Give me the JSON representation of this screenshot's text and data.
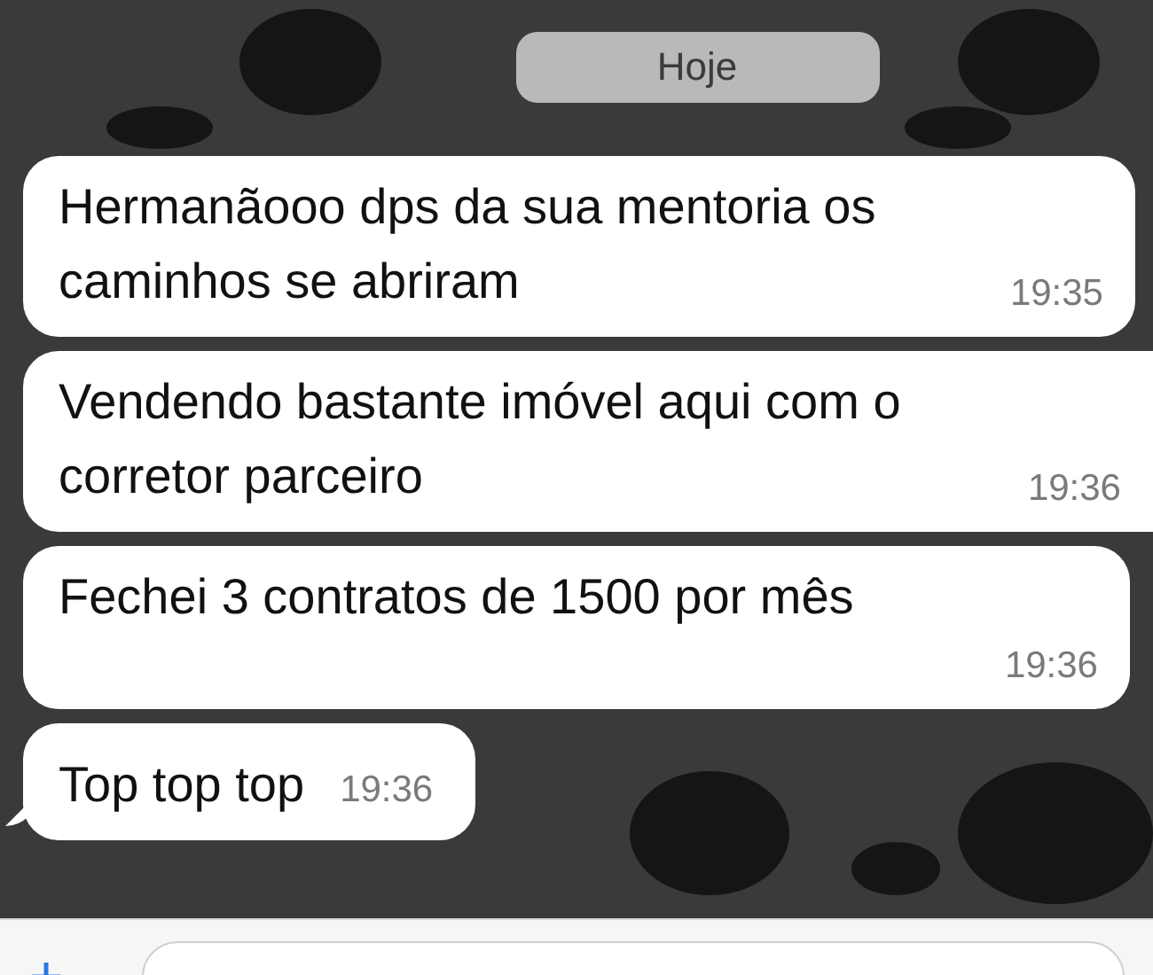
{
  "date_chip": "Hoje",
  "messages": [
    {
      "text": "Hermanãooo dps da sua mentoria os caminhos se abriram",
      "time": "19:35",
      "tail": false
    },
    {
      "text": "Vendendo bastante imóvel aqui com o corretor parceiro",
      "time": "19:36",
      "tail": false
    },
    {
      "text": "Fechei 3 contratos de 1500 por mês",
      "time": "19:36",
      "tail": false
    },
    {
      "text": "Top top top",
      "time": "19:36",
      "tail": true
    }
  ]
}
